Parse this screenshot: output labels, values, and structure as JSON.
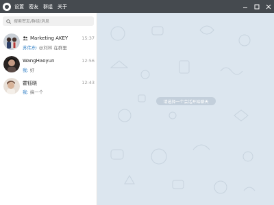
{
  "titlebar": {
    "menu": [
      "设置",
      "密友",
      "群组",
      "关于"
    ],
    "controls": [
      "minimize",
      "maximize",
      "close"
    ]
  },
  "sidebar": {
    "search": {
      "placeholder": "搜索密友/群组/消息",
      "value": ""
    },
    "chats": [
      {
        "name": "Marketing  AKEY",
        "is_group": true,
        "time": "15:37",
        "preview_sender": "苏伟东: ",
        "preview_text": "@刘林   在群里",
        "avatar": "couple-photo"
      },
      {
        "name": "WangHaoyun",
        "is_group": false,
        "time": "12:56",
        "preview_sender": "我: ",
        "preview_text": "好",
        "avatar": "dark-portrait"
      },
      {
        "name": "霍钰晓",
        "is_group": false,
        "time": "12:43",
        "preview_sender": "我: ",
        "preview_text": "搞一个",
        "avatar": "light-portrait"
      }
    ]
  },
  "main": {
    "empty_hint": "请选择一个会话开始聊天"
  },
  "colors": {
    "titlebar": "#454a4f",
    "chat_background": "#dce6ef",
    "sender_accent": "#3f88c9"
  }
}
